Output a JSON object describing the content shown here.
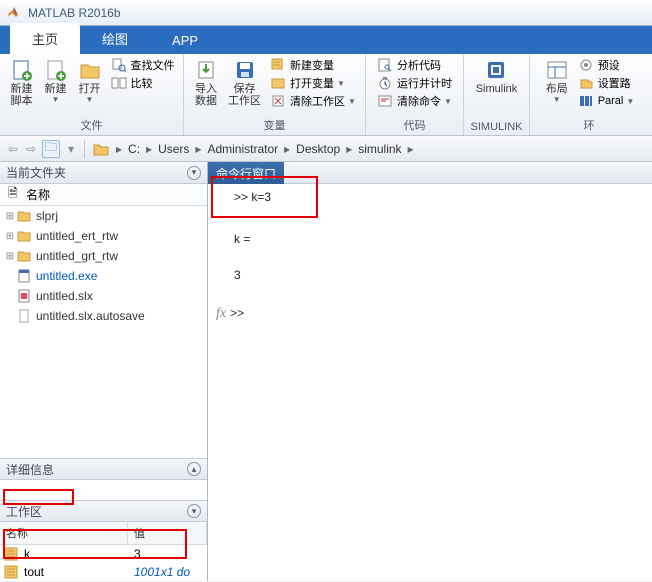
{
  "title": "MATLAB R2016b",
  "tabs": {
    "home": "主页",
    "plot": "绘图",
    "app": "APP"
  },
  "ribbon": {
    "group_file": "文件",
    "new_script": "新建\n脚本",
    "new": "新建",
    "open": "打开",
    "find_files": "查找文件",
    "compare": "比较",
    "group_var": "变量",
    "import_data": "导入\n数据",
    "save_ws": "保存\n工作区",
    "new_var": "新建变量",
    "open_var": "打开变量",
    "clear_ws": "清除工作区",
    "group_code": "代码",
    "analyze": "分析代码",
    "runtime": "运行并计时",
    "clear_cmd": "清除命令",
    "group_simulink": "SIMULINK",
    "simulink": "Simulink",
    "group_env": "环",
    "layout": "布局",
    "prefs": "预设",
    "setpath": "设置路",
    "parallel": "Paral"
  },
  "path": {
    "drive": "C:",
    "p1": "Users",
    "p2": "Administrator",
    "p3": "Desktop",
    "p4": "simulink"
  },
  "left": {
    "current_folder": "当前文件夹",
    "name_col": "名称",
    "f1": "slprj",
    "f2": "untitled_ert_rtw",
    "f3": "untitled_grt_rtw",
    "f4": "untitled.exe",
    "f5": "untitled.slx",
    "f6": "untitled.slx.autosave",
    "details": "详细信息",
    "workspace": "工作区",
    "wname": "名称",
    "wval": "值",
    "var_k": "k",
    "var_k_val": "3",
    "var_tout": "tout",
    "var_tout_val": "1001x1 do"
  },
  "cmd": {
    "header": "命令行窗口",
    "in1": ">> k=3",
    "out1": "k =",
    "out2": "    3",
    "prompt": ">>"
  }
}
